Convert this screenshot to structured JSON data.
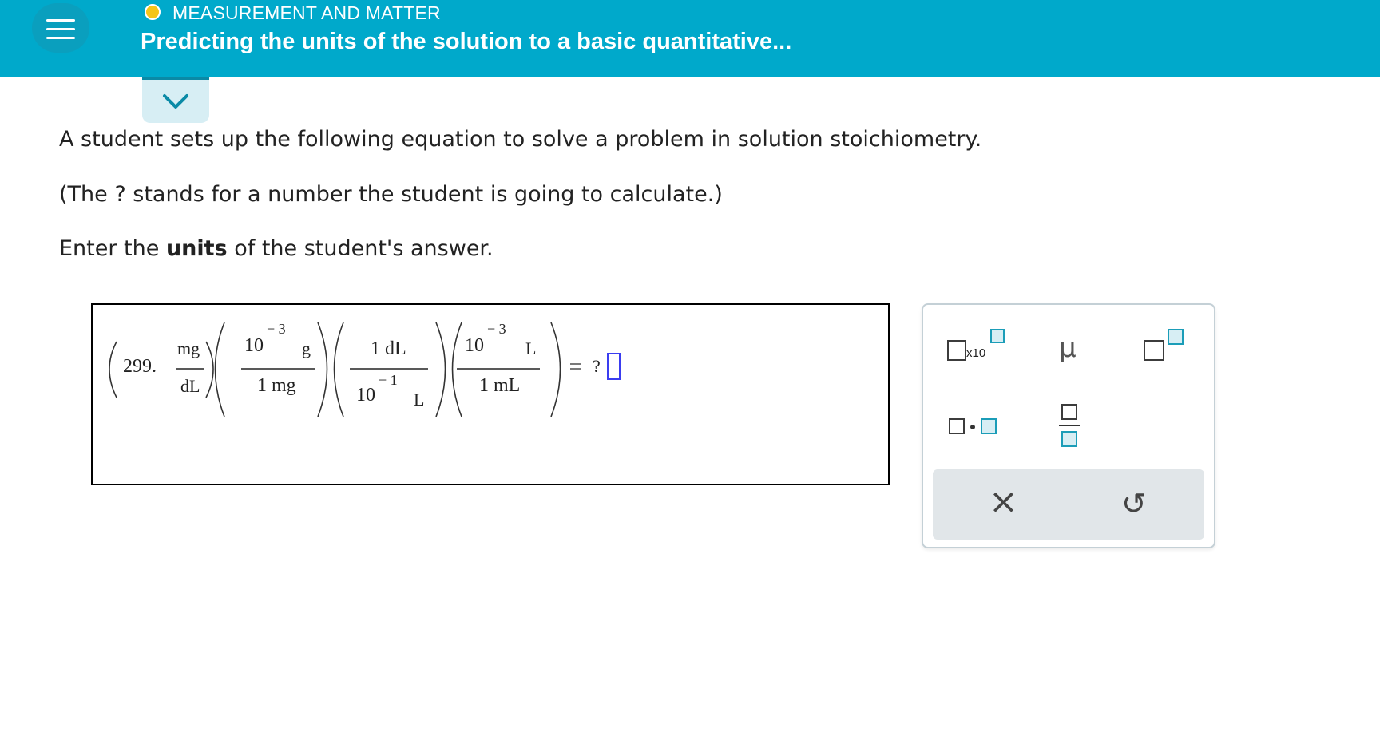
{
  "header": {
    "topic": "MEASUREMENT AND MATTER",
    "title": "Predicting the units of the solution to a basic quantitative..."
  },
  "question": {
    "line1": "A student sets up the following equation to solve a problem in solution stoichiometry.",
    "line2": "(The ? stands for a number the student is going to calculate.)",
    "line3_prefix": "Enter the ",
    "line3_bold": "units",
    "line3_suffix": " of the student's answer."
  },
  "equation": {
    "coefficient": "299.",
    "f1_num": "mg",
    "f1_den": "dL",
    "f2_num_base": "10",
    "f2_num_exp": "− 3",
    "f2_num_unit": "g",
    "f2_den": "1 mg",
    "f3_num": "1 dL",
    "f3_den_base": "10",
    "f3_den_exp": "− 1",
    "f3_den_unit": "L",
    "f4_num_base": "10",
    "f4_num_exp": "− 3",
    "f4_num_unit": "L",
    "f4_den": "1 mL",
    "equals": "=",
    "unknown": "?"
  },
  "palette": {
    "sci_label": "x10",
    "mu": "μ",
    "clear": "×",
    "undo": "↺"
  },
  "colors": {
    "header": "#00a9cb",
    "topic_dot": "#f5c518",
    "answer_box": "#3a3df0",
    "palette_accent": "#1b9db8"
  }
}
